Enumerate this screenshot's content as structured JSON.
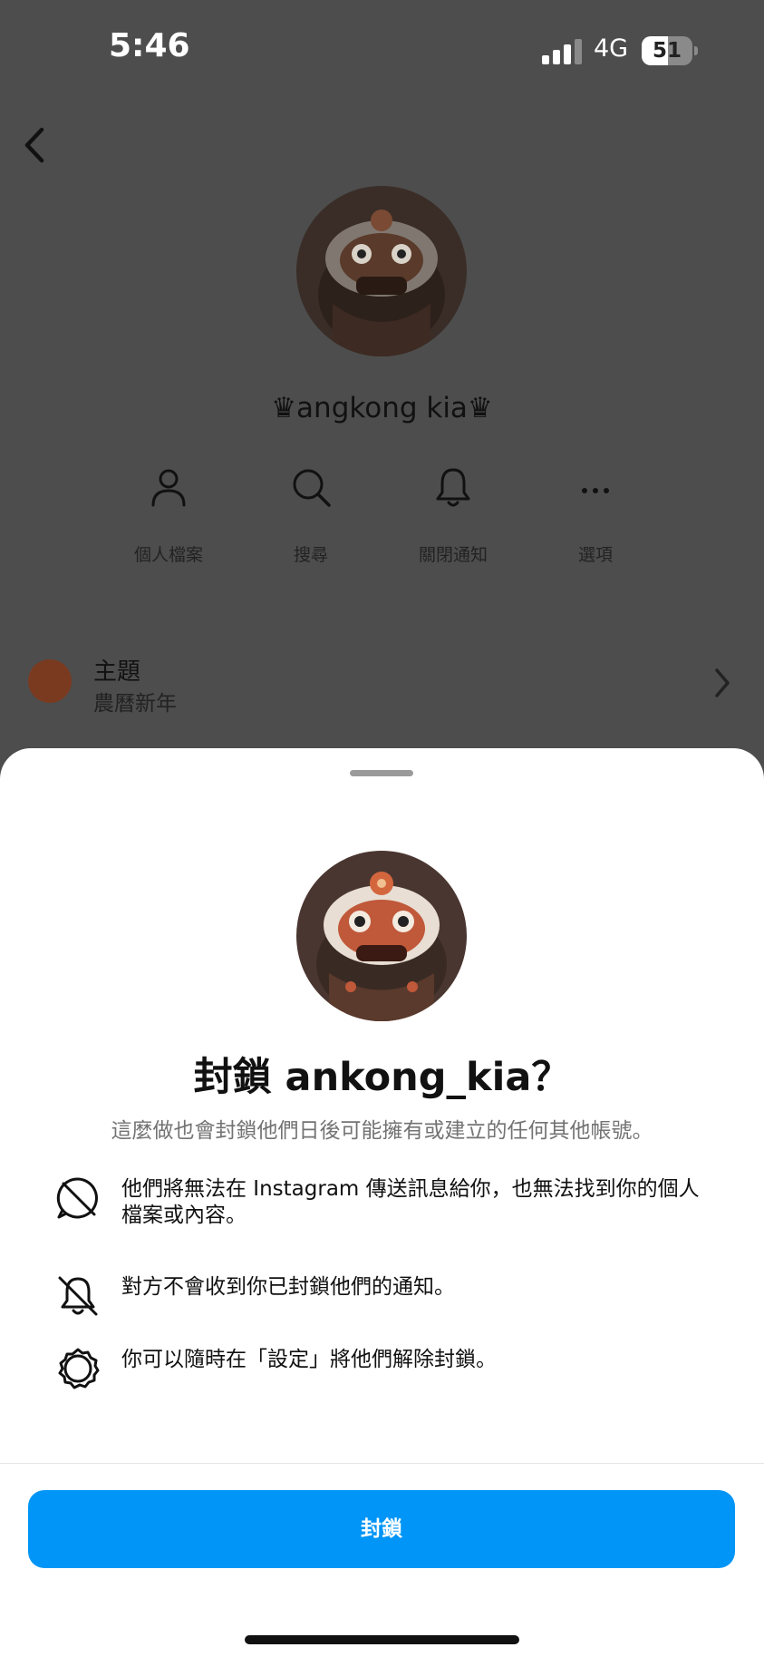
{
  "status_bar": {
    "time": "5:46",
    "network": "4G",
    "battery_level": "51",
    "battery_percent": 51,
    "signal_bars_active": 3
  },
  "profile": {
    "name": "♛angkong kia♛",
    "actions": [
      {
        "label": "個人檔案",
        "icon": "person-icon"
      },
      {
        "label": "搜尋",
        "icon": "search-icon"
      },
      {
        "label": "關閉通知",
        "icon": "bell-icon"
      },
      {
        "label": "選項",
        "icon": "more-icon"
      }
    ],
    "theme": {
      "title": "主題",
      "subtitle": "農曆新年"
    }
  },
  "sheet": {
    "title": "封鎖 ankong_kia？",
    "subtitle": "這麼做也會封鎖他們日後可能擁有或建立的任何其他帳號。",
    "items": [
      {
        "icon": "blocked-message-icon",
        "text": "他們將無法在 Instagram 傳送訊息給你，也無法找到你的個人檔案或內容。"
      },
      {
        "icon": "bell-off-icon",
        "text": "對方不會收到你已封鎖他們的通知。"
      },
      {
        "icon": "settings-gear-icon",
        "text": "你可以隨時在「設定」將他們解除封鎖。"
      }
    ],
    "button_label": "封鎖"
  },
  "colors": {
    "accent": "#0095f6",
    "overlay": "#4d4d4d",
    "sheet_bg": "#ffffff"
  }
}
